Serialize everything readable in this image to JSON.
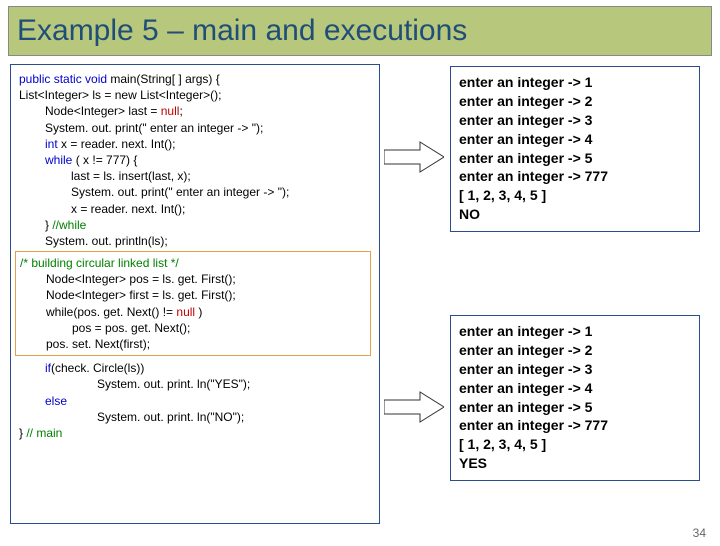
{
  "title": "Example 5 – main and executions",
  "code": {
    "l1a": "public static void",
    "l1b": " main(String[ ] args) {",
    "l2": "List<Integer>    ls = new List<Integer>();",
    "l3a": "Node<Integer>  last = ",
    "l3b": "null",
    "l3c": ";",
    "l4": "System. out. print(\" enter an integer -> \");",
    "l5a": "int",
    "l5b": " x = reader. next. Int();",
    "l6a": "while",
    "l6b": " ( x != 777) {",
    "l7": "last = ls. insert(last, x);",
    "l8": "System. out. print(\" enter an integer -> \");",
    "l9": "x = reader. next. Int();",
    "l10a": "} ",
    "l10b": "//while",
    "l11": "System. out. println(ls);",
    "h1": "/* building circular linked list */",
    "h2": "Node<Integer>  pos = ls. get. First();",
    "h3": "Node<Integer>  first = ls. get. First();",
    "h4a": "while(pos. get. Next() != ",
    "h4b": "null",
    "h4c": " )",
    "h5": "pos = pos. get. Next();",
    "h6": "pos. set. Next(first);",
    "l12a": "if",
    "l12b": "(check. Circle(ls))",
    "l13": "System. out. print. ln(\"YES\");",
    "l14": "else",
    "l15": "System. out. print. ln(\"NO\");",
    "l16a": "} ",
    "l16b": "// main"
  },
  "output1": {
    "l1": "enter an integer ->  1",
    "l2": "enter an integer ->  2",
    "l3": "enter an integer ->  3",
    "l4": "enter an integer ->  4",
    "l5": "enter an integer ->  5",
    "l6": "enter an integer ->  777",
    "l7": "[ 1, 2, 3, 4, 5 ]",
    "l8": "NO"
  },
  "output2": {
    "l1": "enter an integer ->  1",
    "l2": "enter an integer ->  2",
    "l3": "enter an integer ->  3",
    "l4": "enter an integer ->  4",
    "l5": "enter an integer ->  5",
    "l6": "enter an integer ->  777",
    "l7": "[ 1, 2, 3, 4, 5 ]",
    "l8": "YES"
  },
  "slide_number": "34"
}
